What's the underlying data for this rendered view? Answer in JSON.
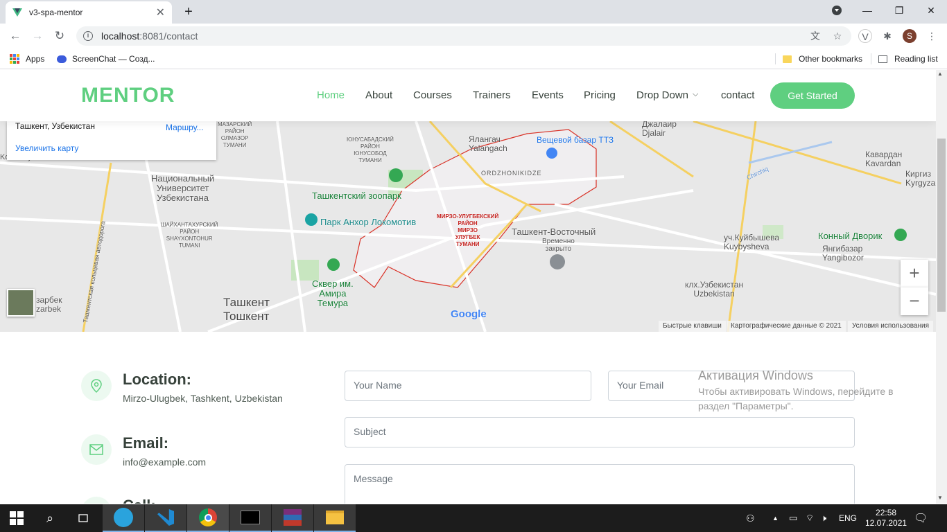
{
  "browser": {
    "tab_title": "v3-spa-mentor",
    "url_host": "localhost",
    "url_rest": ":8081/contact",
    "profile_initial": "S",
    "bookmarks": [
      "Apps",
      "ScreenChat — Созд...",
      "Other bookmarks",
      "Reading list"
    ]
  },
  "header": {
    "logo": "MENTOR",
    "nav": [
      "Home",
      "About",
      "Courses",
      "Trainers",
      "Events",
      "Pricing",
      "Drop Down",
      "contact"
    ],
    "cta": "Get Started"
  },
  "map": {
    "card_address": "Ташкент, Узбекистан",
    "card_route": "Маршру...",
    "card_enlarge": "Увеличить карту",
    "labels": {
      "yalangach": "Ялангач",
      "yalangach_lat": "Yalangach",
      "bazar": "Вещевой базар ТТЗ",
      "djalair": "Джалаир",
      "djalair_lat": "Djalair",
      "kavardan": "Кавардан",
      "kavardan_lat": "Kavardan",
      "kirgiz": "Киргиз",
      "kirgiz_lat": "Kyrgyza",
      "ordzh": "ORDZHONIKIDZE",
      "yunusabad": "ЮНУСАБАДСКИЙ\nРАЙОН\nЮНУСОБОД\nТУМАНИ",
      "mazar": "МАЗАРСКИЙ\nРАЙОН\nОЛМАЗОР\nТУМАНИ",
      "zoo": "Ташкентский зоопарк",
      "univ": "Национальный\nУниверситет\nУзбекистана",
      "park": "Парк Анхор Локомотив",
      "shaykh": "ШАЙХАНТАХУРСКИЙ\nРАЙОН\nSHAYXONTOHUR\nTUMANI",
      "mirzo": "МИРЗО-УЛУГБЕКСКИЙ\nРАЙОН\nМИРЗО\nУЛУГБЕК\nТУМАНИ",
      "vostochny": "Ташкент-Восточный",
      "vremenno": "Временно\nзакрыто",
      "kuybysheva": "уч.Куйбышева",
      "kuybysheva_lat": "Kuybysheva",
      "konny": "Конный Дворик",
      "yangibazar": "Янгибазар",
      "yangibazar_lat": "Yangibozor",
      "klh": "клх.Узбекистан",
      "klh_lat": "Uzbekistan",
      "sqver": "Сквер им.\nАмира\nТемура",
      "tashkent": "Ташкент",
      "toshkent": "Тошкент",
      "zarbek": "зарбек",
      "zarbek_lat": "zarbek",
      "koksaray": "Koksaray",
      "road": "Ташкентская кольцевая автодорога",
      "chirchiq": "Chirchiq",
      "google": "Google"
    },
    "footer": [
      "Быстрые клавиши",
      "Картографические данные © 2021",
      "Условия использования"
    ]
  },
  "contact": {
    "location_title": "Location:",
    "location_text": "Mirzo-Ulugbek, Tashkent, Uzbekistan",
    "email_title": "Email:",
    "email_text": "info@example.com",
    "call_title": "Call:",
    "name_placeholder": "Your Name",
    "email_placeholder": "Your Email",
    "subject_placeholder": "Subject",
    "message_placeholder": "Message"
  },
  "windows": {
    "activation_title": "Активация Windows",
    "activation_text": "Чтобы активировать Windows, перейдите в\nраздел \"Параметры\".",
    "lang": "ENG",
    "time": "22:58",
    "date": "12.07.2021"
  },
  "colors": {
    "accent": "#5fcf80",
    "nav_text": "#37423b"
  }
}
